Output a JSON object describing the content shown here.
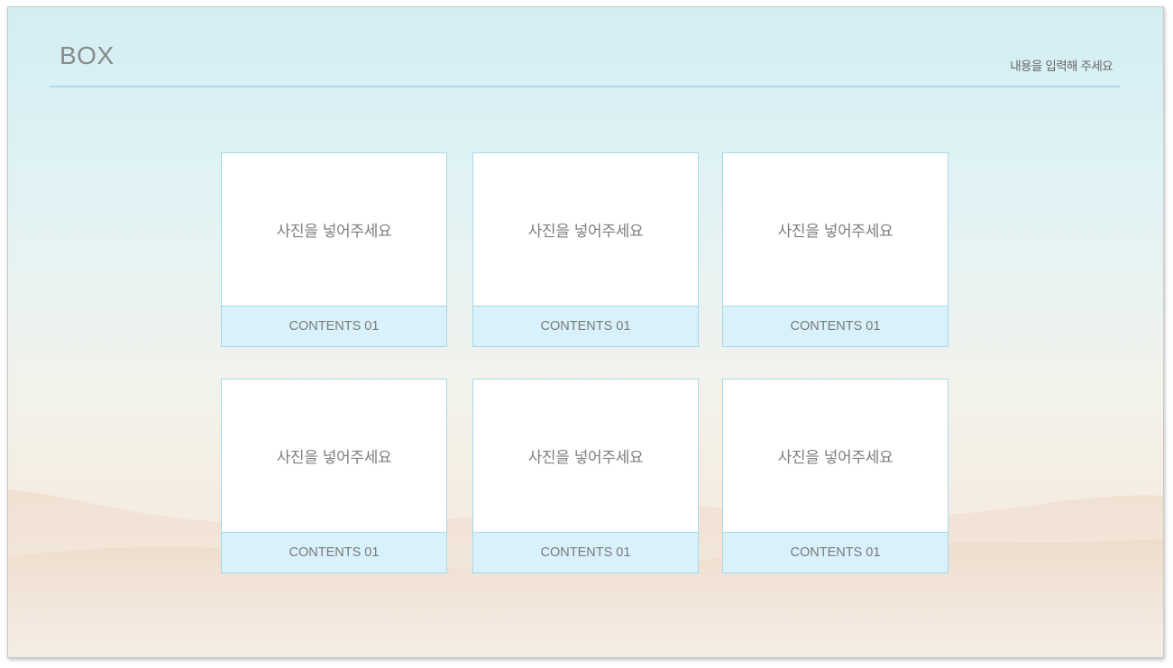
{
  "header": {
    "title": "BOX",
    "subtitle": "내용을 입력해 주세요"
  },
  "cards": [
    {
      "photo_placeholder": "사진을 넣어주세요",
      "caption": "CONTENTS 01"
    },
    {
      "photo_placeholder": "사진을 넣어주세요",
      "caption": "CONTENTS 01"
    },
    {
      "photo_placeholder": "사진을 넣어주세요",
      "caption": "CONTENTS 01"
    },
    {
      "photo_placeholder": "사진을 넣어주세요",
      "caption": "CONTENTS 01"
    },
    {
      "photo_placeholder": "사진을 넣어주세요",
      "caption": "CONTENTS 01"
    },
    {
      "photo_placeholder": "사진을 넣어주세요",
      "caption": "CONTENTS 01"
    }
  ],
  "colors": {
    "rule": "#a9dcef",
    "card_border": "#a7d9ec",
    "caption_bg": "#d8f1fb",
    "sky": "#d3eef3",
    "sand": "#f3e9df"
  }
}
